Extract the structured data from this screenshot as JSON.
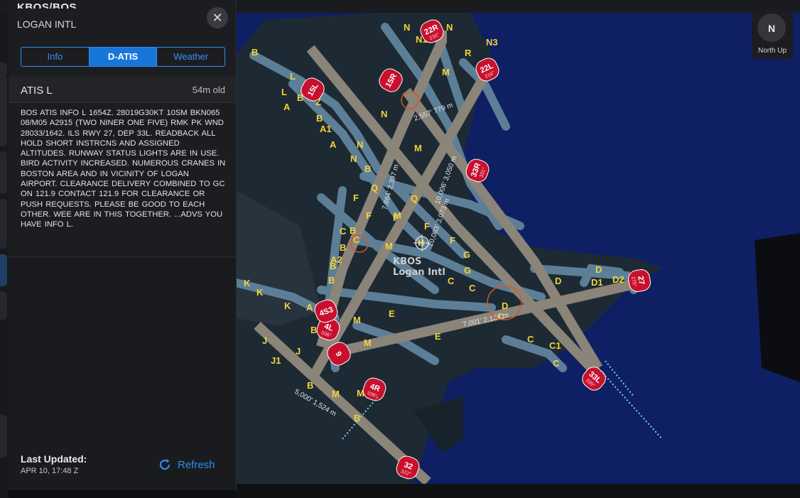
{
  "app": {
    "header_title": ""
  },
  "airport": {
    "code": "KBOS/BOS",
    "name": "LOGAN INTL"
  },
  "tabs": [
    {
      "label": "Info",
      "active": false
    },
    {
      "label": "D-ATIS",
      "active": true
    },
    {
      "label": "Weather",
      "active": false
    }
  ],
  "atis": {
    "title": "ATIS L",
    "age": "54m old",
    "text": "BOS ATIS INFO L 1654Z. 28019G30KT 10SM BKN065 08/M05 A2915 (TWO NINER ONE FIVE) RMK PK WND 28033/1642. ILS RWY 27, DEP 33L. READBACK ALL HOLD SHORT INSTRCNS AND ASSIGNED ALTITUDES. RUNWAY STATUS LIGHTS ARE IN USE. BIRD ACTIVITY INCREASED. NUMEROUS CRANES IN BOSTON AREA AND IN VICINITY OF LOGAN AIRPORT. CLEARANCE DELIVERY COMBINED TO GC ON 121.9 CONTACT 121.9 FOR CLEARANCE OR PUSH REQUESTS. PLEASE BE GOOD TO EACH OTHER. WEE ARE IN THIS TOGETHER. ...ADVS YOU HAVE INFO L."
  },
  "footer": {
    "last_updated_label": "Last Updated:",
    "last_updated_time": "APR 10, 17:48 Z",
    "refresh_label": "Refresh"
  },
  "compass": {
    "letter": "N",
    "label": "North Up"
  },
  "map": {
    "airport_code": "KBOS",
    "airport_name": "Logan Intl",
    "runway_labels": [
      "22R",
      "22L",
      "15L",
      "15R",
      "33R",
      "27",
      "33L",
      "4L",
      "4R",
      "9",
      "32",
      "4S3"
    ],
    "runway_sublabels": [
      "216°",
      "216°",
      "",
      "",
      "331°",
      "275°",
      "330°",
      "036°",
      "036°",
      "",
      "322°",
      ""
    ],
    "distances": [
      "2,557' 779 m",
      "10,006' 3,050 m",
      "10,083' 3,073 m",
      "7,864' 2,397 m",
      "7,001' 2,134 m",
      "5,000' 1,524 m"
    ],
    "taxiway_labels": [
      "B",
      "L",
      "L",
      "B",
      "A",
      "Z",
      "B",
      "A1",
      "A",
      "N",
      "N",
      "B",
      "N",
      "M",
      "M",
      "N",
      "N1",
      "N3",
      "R",
      "N",
      "F",
      "Q",
      "F",
      "B",
      "F",
      "M",
      "Q",
      "C",
      "B",
      "C",
      "M",
      "F",
      "B",
      "A2",
      "B",
      "H",
      "F",
      "G",
      "C",
      "G",
      "C",
      "D",
      "D",
      "D1",
      "D2",
      "D",
      "C",
      "E",
      "E",
      "M",
      "M",
      "K",
      "K",
      "K",
      "A",
      "B",
      "J",
      "J",
      "J1",
      "B",
      "M",
      "M",
      "B",
      "C",
      "C1",
      "C"
    ],
    "colors": {
      "water": "#0f1f63",
      "land": "#1d2a33",
      "taxiway": "#5c7f97",
      "runway": "#8a8479",
      "label": "#f2d23a",
      "runway_badge": "#c8102e"
    }
  }
}
